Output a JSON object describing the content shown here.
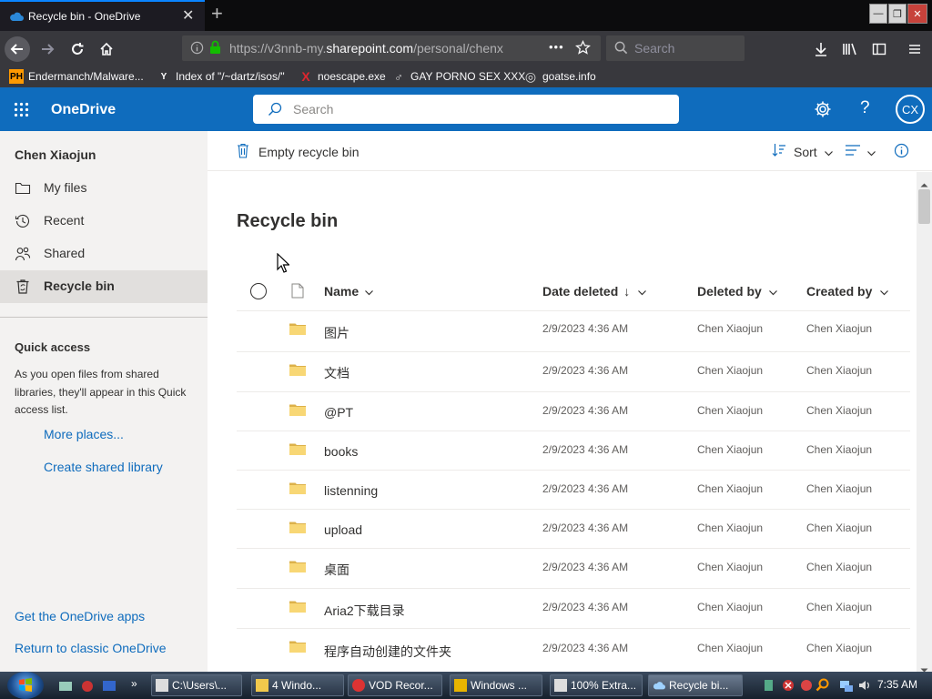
{
  "browser": {
    "tab_title": "Recycle bin - OneDrive",
    "tab_close": "✕",
    "new_tab": "+",
    "url_prefix": "https://v3nnb-my.",
    "url_domain": "sharepoint.com",
    "url_rest": "/personal/chenx",
    "url_more": "•••",
    "search_placeholder": "Search",
    "window_buttons": [
      "—",
      "❐",
      "✕"
    ]
  },
  "bookmarks": [
    {
      "badge": "PH",
      "label": "Endermanch/Malware..."
    },
    {
      "badge": "Y",
      "label": "Index of \"/~dartz/isos/\""
    },
    {
      "badge": "X",
      "label": "noescape.exe"
    },
    {
      "badge": "♂",
      "label": "GAY PORNO SEX XXX"
    },
    {
      "badge": "◎",
      "label": "goatse.info"
    }
  ],
  "header": {
    "app_name": "OneDrive",
    "search_placeholder": "Search",
    "avatar_initials": "CX",
    "help": "?"
  },
  "sidebar": {
    "user": "Chen Xiaojun",
    "items": [
      {
        "label": "My files"
      },
      {
        "label": "Recent"
      },
      {
        "label": "Shared"
      },
      {
        "label": "Recycle bin"
      }
    ],
    "quick_access_title": "Quick access",
    "quick_access_desc": "As you open files from shared libraries, they'll appear in this Quick access list.",
    "more_places": "More places...",
    "create_library": "Create shared library",
    "get_apps": "Get the OneDrive apps",
    "return_classic": "Return to classic OneDrive"
  },
  "commandbar": {
    "empty_bin": "Empty recycle bin",
    "sort": "Sort"
  },
  "main": {
    "title": "Recycle bin",
    "columns": [
      "Name",
      "Date deleted",
      "Deleted by",
      "Created by"
    ],
    "sort_arrow": "↓",
    "rows": [
      {
        "name": "图片",
        "date": "2/9/2023 4:36 AM",
        "deleted_by": "Chen Xiaojun",
        "created_by": "Chen Xiaojun"
      },
      {
        "name": "文档",
        "date": "2/9/2023 4:36 AM",
        "deleted_by": "Chen Xiaojun",
        "created_by": "Chen Xiaojun"
      },
      {
        "name": "@PT",
        "date": "2/9/2023 4:36 AM",
        "deleted_by": "Chen Xiaojun",
        "created_by": "Chen Xiaojun"
      },
      {
        "name": "books",
        "date": "2/9/2023 4:36 AM",
        "deleted_by": "Chen Xiaojun",
        "created_by": "Chen Xiaojun"
      },
      {
        "name": "listenning",
        "date": "2/9/2023 4:36 AM",
        "deleted_by": "Chen Xiaojun",
        "created_by": "Chen Xiaojun"
      },
      {
        "name": "upload",
        "date": "2/9/2023 4:36 AM",
        "deleted_by": "Chen Xiaojun",
        "created_by": "Chen Xiaojun"
      },
      {
        "name": "桌面",
        "date": "2/9/2023 4:36 AM",
        "deleted_by": "Chen Xiaojun",
        "created_by": "Chen Xiaojun"
      },
      {
        "name": "Aria2下载目录",
        "date": "2/9/2023 4:36 AM",
        "deleted_by": "Chen Xiaojun",
        "created_by": "Chen Xiaojun"
      },
      {
        "name": "程序自动创建的文件夹",
        "date": "2/9/2023 4:36 AM",
        "deleted_by": "Chen Xiaojun",
        "created_by": "Chen Xiaojun"
      }
    ]
  },
  "taskbar": {
    "buttons": [
      {
        "label": "C:\\Users\\..."
      },
      {
        "label": "4 Windo..."
      },
      {
        "label": "VOD Recor..."
      },
      {
        "label": "Windows ..."
      },
      {
        "label": "100% Extra..."
      },
      {
        "label": "Recycle bi..."
      }
    ],
    "quicklaunch_more": "»",
    "clock": "7:35 AM"
  },
  "colors": {
    "onedrive_blue": "#0f6cbd",
    "folder_yellow": "#f8d775",
    "firefox_dark": "#38383d"
  }
}
